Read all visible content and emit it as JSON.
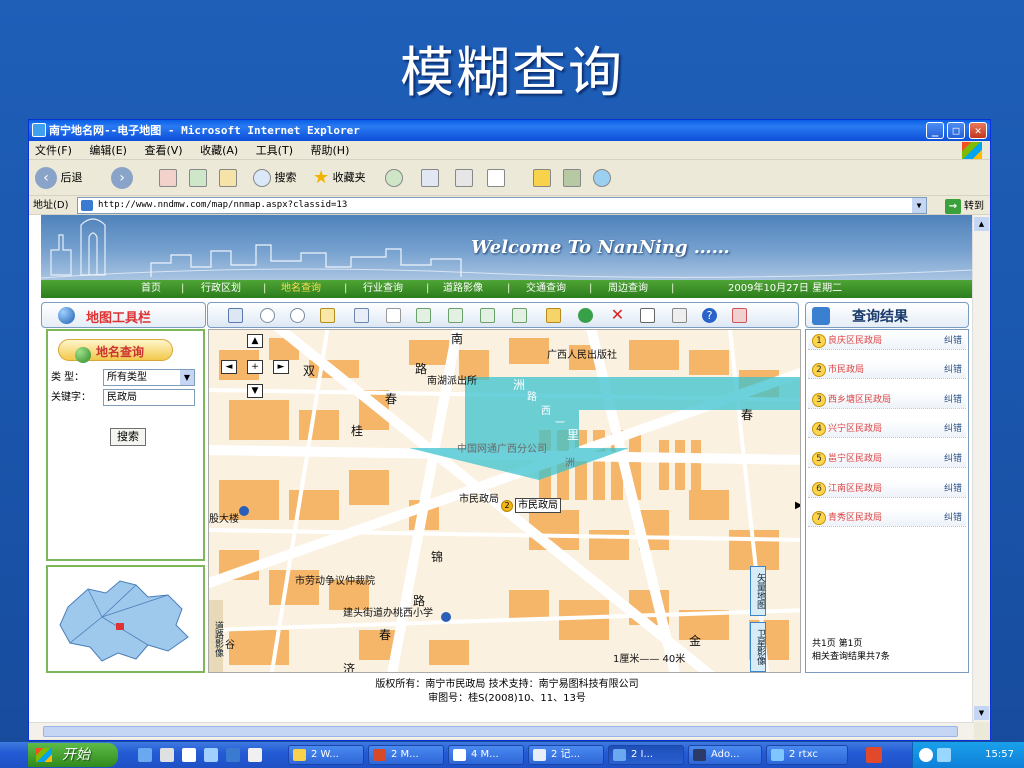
{
  "slide": {
    "title": "模糊查询"
  },
  "window": {
    "title": "南宁地名网--电子地图 - Microsoft Internet Explorer",
    "controls": {
      "minimize": "_",
      "maximize": "□",
      "close": "✕"
    }
  },
  "menu": [
    "文件(F)",
    "编辑(E)",
    "查看(V)",
    "收藏(A)",
    "工具(T)",
    "帮助(H)"
  ],
  "toolbar": {
    "back": "后退",
    "search": "搜索",
    "favorites": "收藏夹"
  },
  "address": {
    "label": "地址(D)",
    "url": "http://www.nndmw.com/map/nnmap.aspx?classid=13",
    "go": "转到"
  },
  "banner": {
    "title": "Welcome  To  NanNing ……"
  },
  "nav": {
    "items": [
      "首页",
      "行政区划",
      "地名查询",
      "行业查询",
      "道路影像",
      "交通查询",
      "周边查询"
    ],
    "date": "2009年10月27日 星期二"
  },
  "tool_panel": {
    "title": "地图工具栏"
  },
  "search_panel": {
    "title": "地名查询",
    "type_label": "类 型：",
    "type_value": "所有类型",
    "keyword_label": "关键字：",
    "keyword_value": "民政局",
    "button": "搜索"
  },
  "map": {
    "labels": [
      "南",
      "广西人民出版社",
      "路",
      "南湖派出所",
      "双",
      "春",
      "桂",
      "中国网通广西分公司",
      "市民政局",
      "市民政局",
      "股大楼",
      "锦",
      "市劳动争议仲裁院",
      "路",
      "建头街道办桃西小学",
      "春",
      "济",
      "谷",
      "金",
      "洲",
      "路",
      "西",
      "一",
      "里",
      "洲",
      "春"
    ],
    "marker_number": "2",
    "scale": "1厘米—— 40米",
    "side_tabs": {
      "vector": "矢量地图",
      "satellite": "卫星影像",
      "road": "道路影像"
    }
  },
  "results_panel": {
    "title": "查询结果",
    "items": [
      {
        "num": "1",
        "name": "良庆区民政局",
        "action": "纠错"
      },
      {
        "num": "2",
        "name": "市民政局",
        "action": "纠错"
      },
      {
        "num": "3",
        "name": "西乡塘区民政局",
        "action": "纠错"
      },
      {
        "num": "4",
        "name": "兴宁区民政局",
        "action": "纠错"
      },
      {
        "num": "5",
        "name": "邕宁区民政局",
        "action": "纠错"
      },
      {
        "num": "6",
        "name": "江南区民政局",
        "action": "纠错"
      },
      {
        "num": "7",
        "name": "青秀区民政局",
        "action": "纠错"
      }
    ],
    "pager": "共1页 第1页",
    "summary": "相关查询结果共7条"
  },
  "footer": {
    "line1": "版权所有：南宁市民政局     技术支持：南宁易图科技有限公司",
    "line2": "审图号：桂S(2008)10、11、13号"
  },
  "taskbar": {
    "start": "开始",
    "tasks": [
      "2 W...",
      "2 M...",
      "4 M...",
      "2 记...",
      "2 I...",
      "Ado...",
      "2 rtxc"
    ],
    "clock": "15:57"
  }
}
